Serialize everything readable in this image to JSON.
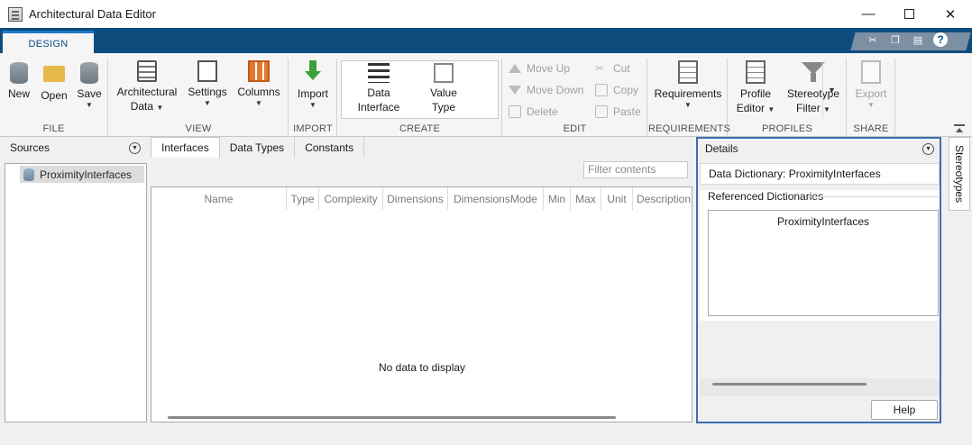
{
  "window": {
    "title": "Architectural Data Editor"
  },
  "ribbon": {
    "tab": "DESIGN",
    "file": {
      "label": "FILE",
      "new": "New",
      "open": "Open",
      "save": "Save"
    },
    "view": {
      "label": "VIEW",
      "arch_line1": "Architectural",
      "arch_line2": "Data",
      "settings": "Settings",
      "columns": "Columns"
    },
    "import": {
      "label": "IMPORT",
      "import": "Import"
    },
    "create": {
      "label": "CREATE",
      "data_interface_l1": "Data",
      "data_interface_l2": "Interface",
      "value_type_l1": "Value",
      "value_type_l2": "Type"
    },
    "edit": {
      "label": "EDIT",
      "move_up": "Move Up",
      "move_down": "Move Down",
      "delete": "Delete",
      "cut": "Cut",
      "copy": "Copy",
      "paste": "Paste"
    },
    "requirements": {
      "label": "REQUIREMENTS",
      "requirements": "Requirements"
    },
    "profiles": {
      "label": "PROFILES",
      "profile_l1": "Profile",
      "profile_l2": "Editor",
      "stereo_l1": "Stereotype",
      "stereo_l2": "Filter"
    },
    "share": {
      "label": "SHARE",
      "export": "Export"
    }
  },
  "sources": {
    "title": "Sources",
    "items": [
      {
        "label": "ProximityInterfaces"
      }
    ]
  },
  "center": {
    "tabs": [
      {
        "label": "Interfaces"
      },
      {
        "label": "Data Types"
      },
      {
        "label": "Constants"
      }
    ],
    "filter_placeholder": "Filter contents",
    "columns": [
      "Name",
      "Type",
      "Complexity",
      "Dimensions",
      "DimensionsMode",
      "Min",
      "Max",
      "Unit",
      "Description"
    ],
    "empty_message": "No data to display"
  },
  "details": {
    "title": "Details",
    "data_dictionary": "Data Dictionary: ProximityInterfaces",
    "referenced_label": "Referenced Dictionaries",
    "referenced": [
      "ProximityInterfaces"
    ],
    "help": "Help"
  },
  "side_tab": {
    "label": "Stereotypes"
  }
}
